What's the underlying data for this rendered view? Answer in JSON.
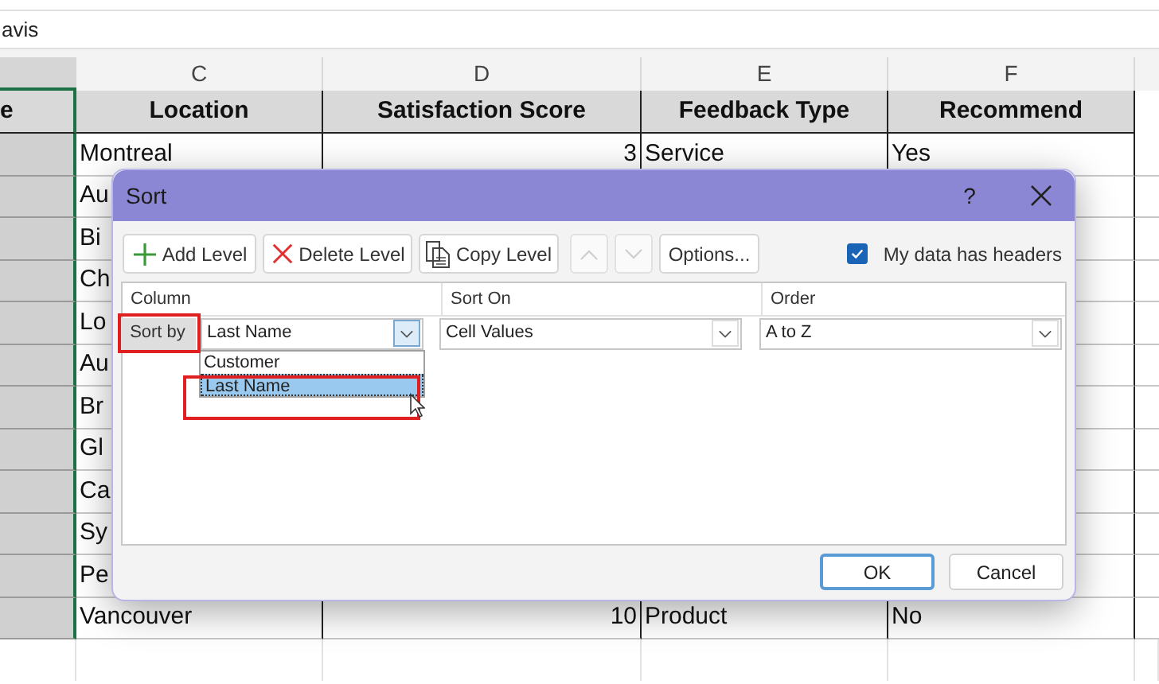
{
  "formula_bar": {
    "value": "avis"
  },
  "column_headers": [
    "C",
    "D",
    "E",
    "F"
  ],
  "header_row": [
    "e",
    "Location",
    "Satisfaction Score",
    "Feedback Type",
    "Recommend"
  ],
  "rows": [
    {
      "selected": true,
      "cells": [
        "Montreal",
        "3",
        "Service",
        "Yes"
      ]
    },
    {
      "selected": true,
      "cells": [
        "Au"
      ]
    },
    {
      "selected": true,
      "cells": [
        "Bi"
      ]
    },
    {
      "selected": true,
      "cells": [
        "Ch"
      ]
    },
    {
      "selected": true,
      "cells": [
        "Lo"
      ]
    },
    {
      "selected": true,
      "cells": [
        "Au"
      ]
    },
    {
      "selected": true,
      "cells": [
        "Br"
      ]
    },
    {
      "selected": true,
      "cells": [
        "Gl"
      ]
    },
    {
      "selected": true,
      "cells": [
        "Ca"
      ]
    },
    {
      "selected": true,
      "cells": [
        "Sy"
      ]
    },
    {
      "selected": true,
      "cells": [
        "Pe"
      ]
    },
    {
      "selected": true,
      "cells": [
        "Vancouver",
        "10",
        "Product",
        "No"
      ]
    }
  ],
  "dialog": {
    "title": "Sort",
    "help": "?",
    "toolbar": [
      {
        "kind": "add",
        "label": "Add Level",
        "disabled": false
      },
      {
        "kind": "delete",
        "label": "Delete Level",
        "disabled": false
      },
      {
        "kind": "copy",
        "label": "Copy Level",
        "disabled": false
      },
      {
        "kind": "up",
        "disabled": true
      },
      {
        "kind": "down",
        "disabled": true
      },
      {
        "kind": "text",
        "label": "Options...",
        "disabled": false
      }
    ],
    "headers_checkbox": {
      "label": "My data has headers",
      "checked": true
    },
    "grid": {
      "columns": [
        "Column",
        "Sort On",
        "Order"
      ],
      "row": {
        "label": "Sort by",
        "column": "Last Name",
        "sort_on": "Cell Values",
        "order": "A to Z"
      }
    },
    "dropdown": {
      "items": [
        {
          "label": "Customer",
          "selected": false
        },
        {
          "label": "Last Name",
          "selected": true
        }
      ]
    },
    "buttons": [
      {
        "label": "OK",
        "default": true
      },
      {
        "label": "Cancel",
        "default": false
      }
    ]
  }
}
